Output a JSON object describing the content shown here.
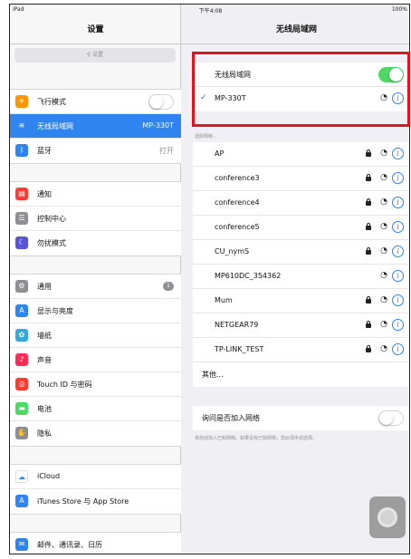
{
  "status_bar": {
    "left": "iPad",
    "time": "下午4:08",
    "battery": "100%"
  },
  "sidebar": {
    "title": "设置",
    "search_placeholder": "设置",
    "groups": [
      [
        {
          "icon": "airplane-icon",
          "color": "#ff9500",
          "label": "飞行模式",
          "toggle": "off"
        },
        {
          "icon": "wifi-icon",
          "color": "#2f84f0",
          "label": "无线局域网",
          "value": "MP-330T",
          "selected": true
        },
        {
          "icon": "bluetooth-icon",
          "color": "#2f84f0",
          "label": "蓝牙",
          "value": "打开"
        }
      ],
      [
        {
          "icon": "notifications-icon",
          "color": "#ff3b30",
          "label": "通知"
        },
        {
          "icon": "control-center-icon",
          "color": "#8e8e93",
          "label": "控制中心"
        },
        {
          "icon": "do-not-disturb-icon",
          "color": "#5856d6",
          "label": "勿扰模式"
        }
      ],
      [
        {
          "icon": "gear-icon",
          "color": "#8e8e93",
          "label": "通用",
          "badge": "1"
        },
        {
          "icon": "display-icon",
          "color": "#2f84f0",
          "label": "显示与亮度"
        },
        {
          "icon": "wallpaper-icon",
          "color": "#34aadc",
          "label": "墙纸"
        },
        {
          "icon": "sounds-icon",
          "color": "#ff2d55",
          "label": "声音"
        },
        {
          "icon": "touch-id-icon",
          "color": "#ff3b30",
          "label": "Touch ID 与密码"
        },
        {
          "icon": "battery-icon",
          "color": "#4cd964",
          "label": "电池"
        },
        {
          "icon": "privacy-hand-icon",
          "color": "#8e8e93",
          "label": "隐私"
        }
      ],
      [
        {
          "icon": "icloud-icon",
          "color": "#ffffff",
          "label": "iCloud"
        },
        {
          "icon": "app-store-icon",
          "color": "#2f84f0",
          "label": "iTunes Store 与 App Store"
        }
      ],
      [
        {
          "icon": "mail-icon",
          "color": "#2f84f0",
          "label": "邮件、通讯录、日历"
        }
      ]
    ]
  },
  "main": {
    "title": "无线局域网",
    "wifi_toggle_label": "无线局域网",
    "wifi_toggle": "on",
    "connected_network": "MP-330T",
    "section_label": "选取网络...",
    "networks": [
      {
        "name": "AP",
        "locked": true
      },
      {
        "name": "conference3",
        "locked": true
      },
      {
        "name": "conference4",
        "locked": true
      },
      {
        "name": "conference5",
        "locked": true
      },
      {
        "name": "CU_nymS",
        "locked": true
      },
      {
        "name": "MP610DC_354362",
        "locked": false
      },
      {
        "name": "Mum",
        "locked": true
      },
      {
        "name": "NETGEAR79",
        "locked": true
      },
      {
        "name": "TP-LINK_TEST",
        "locked": true
      }
    ],
    "other_label": "其他...",
    "ask_to_join_label": "询问是否加入网络",
    "ask_to_join_toggle": "off",
    "ask_to_join_note": "将自动加入已知网络。如果没有已知网络，您必须手动选择。"
  },
  "colors": {
    "accent": "#2f84f0",
    "highlight": "#e5131b",
    "toggle_on": "#4cd964"
  }
}
